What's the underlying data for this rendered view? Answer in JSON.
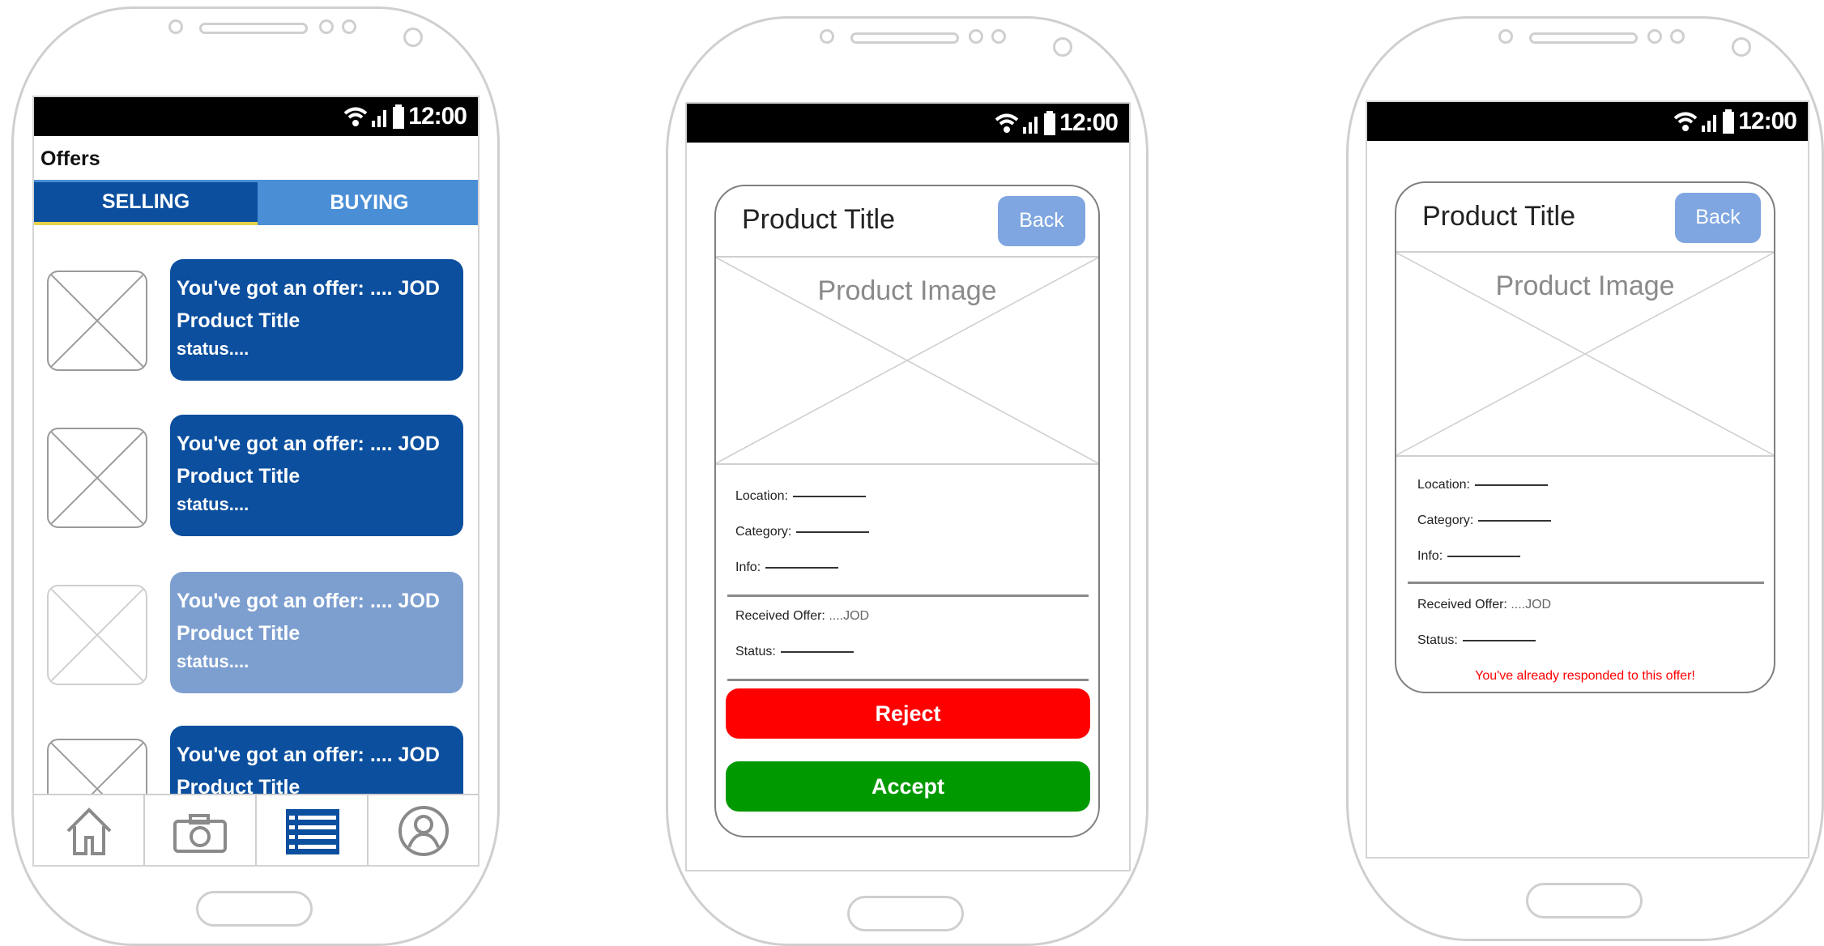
{
  "screen1": {
    "status_time": "12:00",
    "page_title": "Offers",
    "tabs": [
      {
        "label": "SELLING",
        "active": true
      },
      {
        "label": "BUYING",
        "active": false
      }
    ],
    "offers": [
      {
        "line1": "You've got an offer: .... JOD",
        "line2": "Product Title",
        "line3": "status....",
        "color": "#0b4f9e"
      },
      {
        "line1": "You've got an offer: .... JOD",
        "line2": "Product Title",
        "line3": "status....",
        "color": "#0b4f9e"
      },
      {
        "line1": "You've got an offer: .... JOD",
        "line2": "Product Title",
        "line3": "status....",
        "color": "#7d9fd0"
      },
      {
        "line1": "You've got an offer: .... JOD",
        "line2": "Product Title",
        "line3": "",
        "color": "#0b4f9e"
      }
    ],
    "nav": [
      {
        "icon": "home-icon",
        "active": false
      },
      {
        "icon": "camera-icon",
        "active": false
      },
      {
        "icon": "list-icon",
        "active": true
      },
      {
        "icon": "profile-icon",
        "active": false
      }
    ]
  },
  "screen2": {
    "status_time": "12:00",
    "product_title": "Product Title",
    "back_label": "Back",
    "image_label": "Product Image",
    "location_label": "Location:",
    "category_label": "Category:",
    "info_label": "Info:",
    "received_offer_label": "Received Offer:",
    "received_offer_value": "....JOD",
    "status_label": "Status:",
    "reject_label": "Reject",
    "accept_label": "Accept",
    "reject_color": "#ff0000",
    "accept_color": "#009a00"
  },
  "screen3": {
    "status_time": "12:00",
    "product_title": "Product Title",
    "back_label": "Back",
    "image_label": "Product Image",
    "location_label": "Location:",
    "category_label": "Category:",
    "info_label": "Info:",
    "received_offer_label": "Received Offer:",
    "received_offer_value": "....JOD",
    "status_label": "Status:",
    "responded_message": "You've already responded to this offer!",
    "message_color": "#ff0000"
  },
  "colors": {
    "primary": "#0b4f9e",
    "tab_inactive": "#4a8fd6",
    "back_button": "#7fa6e0"
  }
}
